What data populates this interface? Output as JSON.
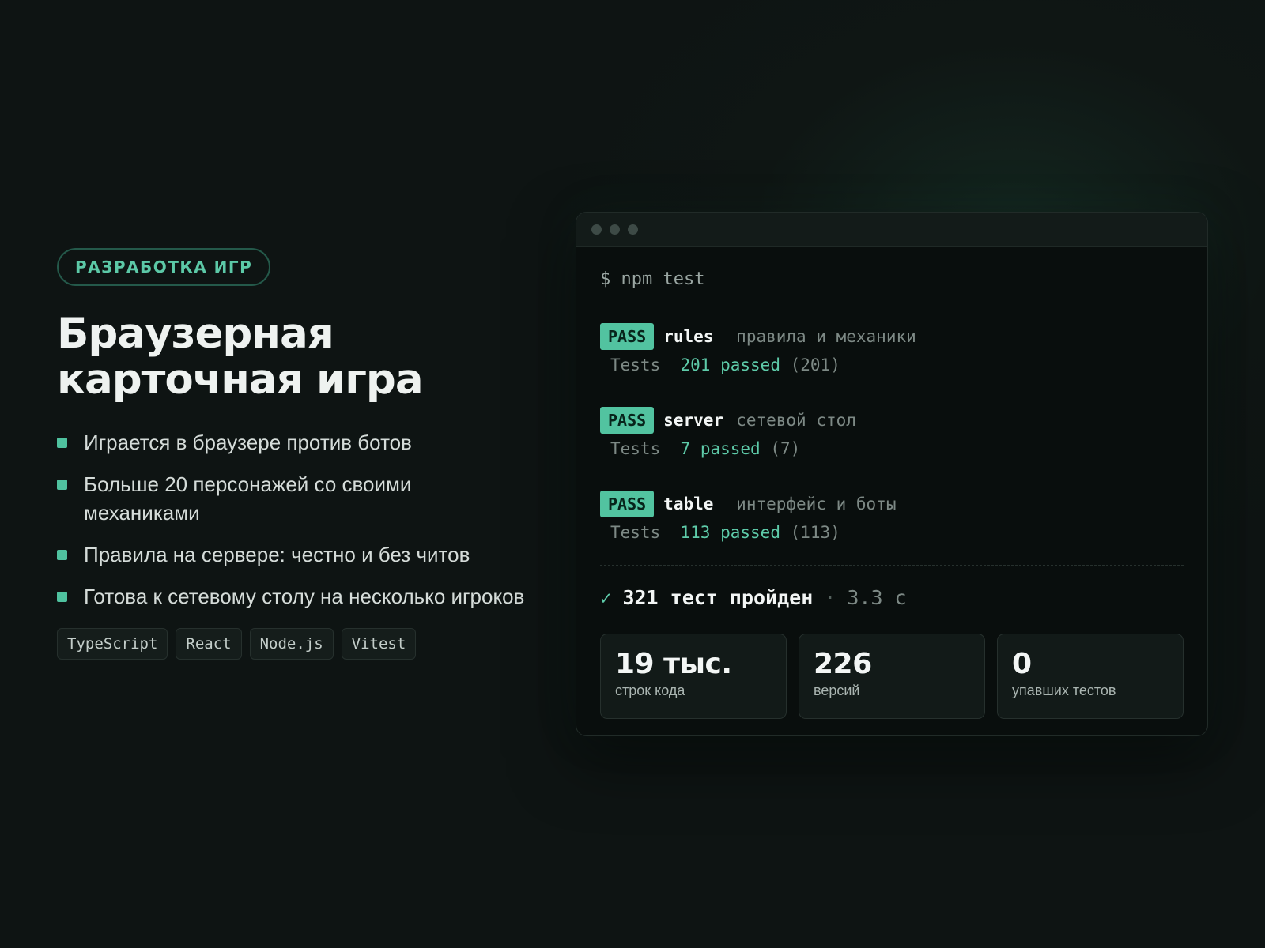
{
  "tag": "РАЗРАБОТКА ИГР",
  "title": [
    "Браузерная",
    "карточная игра"
  ],
  "bullets": [
    "Играется в браузере против ботов",
    "Больше 20 персонажей со своими механиками",
    "Правила на сервере: честно и без читов",
    "Готова к сетевому столу на несколько игроков"
  ],
  "techs": [
    "TypeScript",
    "React",
    "Node.js",
    "Vitest"
  ],
  "terminal": {
    "command": "$ npm test",
    "pass_label": "PASS",
    "tests_label": "Tests",
    "passed_word": "passed",
    "suites": [
      {
        "name": "rules",
        "desc": "правила и механики",
        "passed": "201",
        "total": "(201)"
      },
      {
        "name": "server",
        "desc": "сетевой стол",
        "passed": "7",
        "total": "(7)"
      },
      {
        "name": "table",
        "desc": "интерфейс и боты",
        "passed": "113",
        "total": "(113)"
      }
    ],
    "summary": {
      "check": "✓",
      "text": "321 тест пройден",
      "dot": "·",
      "time": "3.3 с"
    },
    "stats": [
      {
        "value": "19 тыс.",
        "label": "строк кода"
      },
      {
        "value": "226",
        "label": "версий"
      },
      {
        "value": "0",
        "label": "упавших тестов"
      }
    ]
  },
  "colors": {
    "accent": "#52c3a0",
    "background": "#0f1514"
  }
}
